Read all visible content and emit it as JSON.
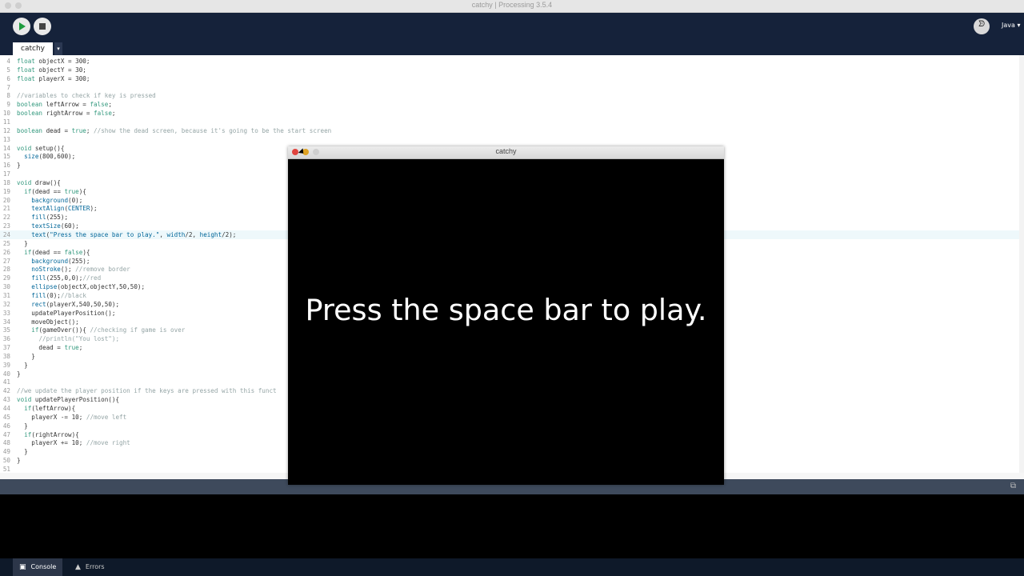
{
  "window": {
    "title": "catchy | Processing 3.5.4"
  },
  "toolbar": {
    "run_icon": "play-icon",
    "stop_icon": "stop-icon",
    "debug_icon": "butterfly-icon",
    "mode_label": "Java ▾",
    "tab_label": "catchy",
    "tab_menu": "▾"
  },
  "editor": {
    "lines": [
      {
        "n": "4",
        "t": "float objectX = 300;"
      },
      {
        "n": "5",
        "t": "float objectY = 30;"
      },
      {
        "n": "6",
        "t": "float playerX = 300;"
      },
      {
        "n": "7",
        "t": ""
      },
      {
        "n": "8",
        "t": "//variables to check if key is pressed"
      },
      {
        "n": "9",
        "t": "boolean leftArrow = false;"
      },
      {
        "n": "10",
        "t": "boolean rightArrow = false;"
      },
      {
        "n": "11",
        "t": ""
      },
      {
        "n": "12",
        "t": "boolean dead = true; //show the dead screen, because it's going to be the start screen"
      },
      {
        "n": "13",
        "t": ""
      },
      {
        "n": "14",
        "t": "void setup(){"
      },
      {
        "n": "15",
        "t": "  size(800,600);"
      },
      {
        "n": "16",
        "t": "}"
      },
      {
        "n": "17",
        "t": ""
      },
      {
        "n": "18",
        "t": "void draw(){"
      },
      {
        "n": "19",
        "t": "  if(dead == true){"
      },
      {
        "n": "20",
        "t": "    background(0);"
      },
      {
        "n": "21",
        "t": "    textAlign(CENTER);"
      },
      {
        "n": "22",
        "t": "    fill(255);"
      },
      {
        "n": "23",
        "t": "    textSize(60);"
      },
      {
        "n": "24",
        "t": "    text(\"Press the space bar to play.\", width/2, height/2);"
      },
      {
        "n": "25",
        "t": "  }"
      },
      {
        "n": "26",
        "t": "  if(dead == false){"
      },
      {
        "n": "27",
        "t": "    background(255);"
      },
      {
        "n": "28",
        "t": "    noStroke(); //remove border"
      },
      {
        "n": "29",
        "t": "    fill(255,0,0);//red"
      },
      {
        "n": "30",
        "t": "    ellipse(objectX,objectY,50,50);"
      },
      {
        "n": "31",
        "t": "    fill(0);//black"
      },
      {
        "n": "32",
        "t": "    rect(playerX,540,50,50);"
      },
      {
        "n": "33",
        "t": "    updatePlayerPosition();"
      },
      {
        "n": "34",
        "t": "    moveObject();"
      },
      {
        "n": "35",
        "t": "    if(gameOver()){ //checking if game is over"
      },
      {
        "n": "36",
        "t": "      //println(\"You lost\");"
      },
      {
        "n": "37",
        "t": "      dead = true;"
      },
      {
        "n": "38",
        "t": "    }"
      },
      {
        "n": "39",
        "t": "  }"
      },
      {
        "n": "40",
        "t": "}"
      },
      {
        "n": "41",
        "t": ""
      },
      {
        "n": "42",
        "t": "//we update the player position if the keys are pressed with this funct"
      },
      {
        "n": "43",
        "t": "void updatePlayerPosition(){"
      },
      {
        "n": "44",
        "t": "  if(leftArrow){"
      },
      {
        "n": "45",
        "t": "    playerX -= 10; //move left"
      },
      {
        "n": "46",
        "t": "  }"
      },
      {
        "n": "47",
        "t": "  if(rightArrow){"
      },
      {
        "n": "48",
        "t": "    playerX += 10; //move right"
      },
      {
        "n": "49",
        "t": "  }"
      },
      {
        "n": "50",
        "t": "}"
      },
      {
        "n": "51",
        "t": ""
      }
    ]
  },
  "sketch": {
    "title": "catchy",
    "message": "Press the space bar to play."
  },
  "bottom": {
    "console_label": "Console",
    "errors_label": "Errors",
    "console_icon": "console-icon",
    "errors_icon": "warning-icon"
  },
  "colors": {
    "toolbar": "#15223a",
    "run_green": "#1f9c3e",
    "keyword": "#33997e",
    "function": "#006699",
    "comment": "#95a5a6"
  }
}
